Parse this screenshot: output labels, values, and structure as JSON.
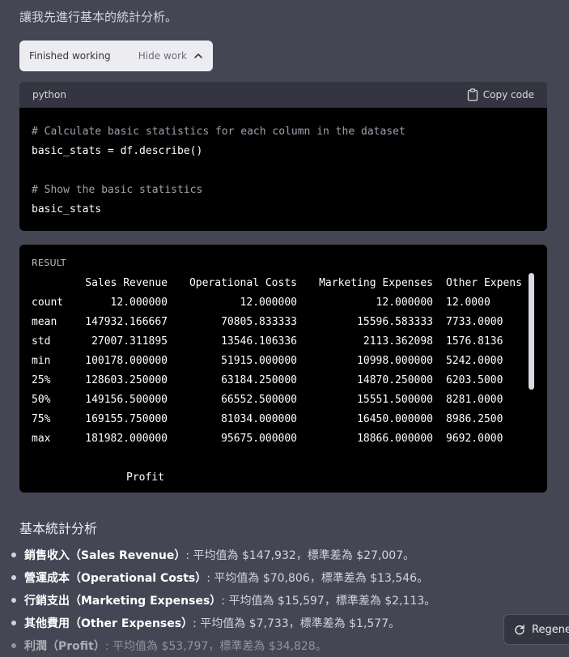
{
  "intro_text": "讓我先進行基本的統計分析。",
  "work_pill": {
    "status": "Finished working",
    "toggle": "Hide work"
  },
  "code": {
    "language": "python",
    "copy_label": "Copy code",
    "lines": [
      "# Calculate basic statistics for each column in the dataset",
      "basic_stats = df.describe()",
      "",
      "# Show the basic statistics",
      "basic_stats"
    ]
  },
  "result": {
    "label": "RESULT",
    "headers": [
      "",
      "Sales Revenue",
      "Operational Costs",
      "Marketing Expenses",
      "Other Expens"
    ],
    "rows": [
      [
        "count",
        "12.000000",
        "12.000000",
        "12.000000",
        "12.0000"
      ],
      [
        "mean",
        "147932.166667",
        "70805.833333",
        "15596.583333",
        "7733.0000"
      ],
      [
        "std",
        "27007.311895",
        "13546.106336",
        "2113.362098",
        "1576.8136"
      ],
      [
        "min",
        "100178.000000",
        "51915.000000",
        "10998.000000",
        "5242.0000"
      ],
      [
        "25%",
        "128603.250000",
        "63184.250000",
        "14870.250000",
        "6203.5000"
      ],
      [
        "50%",
        "149156.500000",
        "66552.500000",
        "15551.500000",
        "8281.0000"
      ],
      [
        "75%",
        "169155.750000",
        "81034.000000",
        "16450.000000",
        "8986.2500"
      ],
      [
        "max",
        "181982.000000",
        "95675.000000",
        "18866.000000",
        "9692.0000"
      ]
    ],
    "profit_header": "Profit"
  },
  "summary": {
    "title": "基本統計分析",
    "items": [
      {
        "bold": "銷售收入（Sales Revenue）",
        "text": ": 平均值為 $147,932，標準差為 $27,007。"
      },
      {
        "bold": "營運成本（Operational Costs）",
        "text": ": 平均值為 $70,806，標準差為 $13,546。"
      },
      {
        "bold": "行銷支出（Marketing Expenses）",
        "text": ": 平均值為 $15,597，標準差為 $2,113。"
      },
      {
        "bold": "其他費用（Other Expenses）",
        "text": ": 平均值為 $7,733，標準差為 $1,577。"
      },
      {
        "bold": "利潤（Profit）",
        "text": ": 平均值為 $53,797，標準差為 $34,828。"
      }
    ]
  },
  "regenerate_label": "Regene"
}
